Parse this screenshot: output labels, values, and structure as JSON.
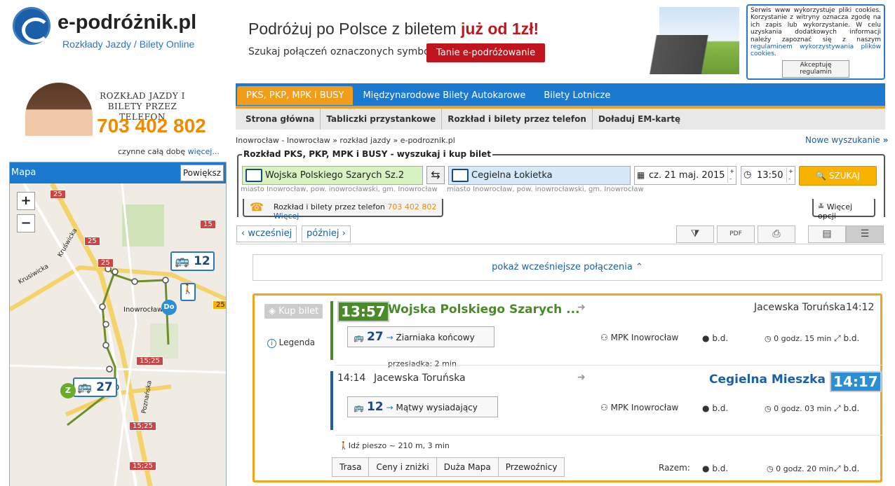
{
  "brand": {
    "name": "e-podróżnik.pl",
    "tagline": "Rozkłady Jazdy / Bilety Online"
  },
  "banner": {
    "line1_a": "Podróżuj po Polsce z biletem ",
    "line1_b": "już od 1zł!",
    "line2": "Szukaj połączeń oznaczonych symbolem",
    "button": "Tanie e-podróżowanie"
  },
  "cookie": {
    "text": "Serwis www wykorzystuje pliki cookies. Korzystanie z witryny oznacza zgodę na ich zapis lub wykorzystanie. W celu uzyskania dodatkowych informacji należy zapoznać się z naszym",
    "link": "regulaminem wykorzystywania plików cookies",
    "dot": ".",
    "accept": "Akceptuję regulamin"
  },
  "phone": {
    "heading": "ROZKŁAD JAZDY I BILETY PRZEZ TELEFON",
    "number": "703 402 802",
    "allday": "czynne całą dobę",
    "more": "więcej..."
  },
  "map": {
    "title": "Mapa",
    "enlarge": "Powiększ",
    "zoom_in": "+",
    "zoom_out": "−",
    "labels": [
      "25",
      "25",
      "25",
      "15",
      "25",
      "15;25",
      "15;25",
      "15;25"
    ],
    "bus1": "12",
    "bus2": "27",
    "dest": "Do",
    "start": "Z",
    "place": "Inowrocław",
    "street": "Poznańska",
    "street2": "Kruświcka",
    "street3": "Krusiwicka"
  },
  "nav": {
    "tabs": [
      "PKS, PKP, MPK i BUSY",
      "Międzynarodowe Bilety Autokarowe",
      "Bilety Lotnicze"
    ],
    "sub": [
      "Strona główna",
      "Tabliczki przystankowe",
      "Rozkład i bilety przez telefon",
      "Doładuj EM-kartę"
    ]
  },
  "breadcrumb": "Inowrocław - Inowrocław » rozkład jazdy » e-podroznik.pl",
  "new_search": "Nowe wyszukanie",
  "search": {
    "title": "Rozkład PKS, PKP, MPK i BUSY - wyszukaj i kup bilet",
    "from": "Wojska Polskiego  Szarych Sz.2",
    "from_sub": "miasto Inowrocław, pow. inowrocławski, gm. Inowrocław",
    "to": "Cegielna Łokietka",
    "to_sub": "miasto Inowrocław, pow. inowrocławski, gm. Inowrocław",
    "date": "cz. 21 maj. 2015",
    "time": "13:50",
    "button": "SZUKAJ",
    "phone_tab": "Rozkład i bilety przez telefon",
    "phone_num": "703 402 802",
    "phone_more": "Więcej",
    "options": "Więcej opcji"
  },
  "pager": {
    "earlier": "wcześniej",
    "later": "później",
    "show_earlier": "pokaż wcześniejsze połączenia"
  },
  "result": {
    "buy": "Kup bilet",
    "legend": "Legenda",
    "leg1": {
      "dep": "13:57",
      "from": "Wojska Polskiego Szarych ...",
      "to": "Jacewska Toruńska",
      "arr": "14:12",
      "line": "27",
      "dir": "Ziarniaka końcowy",
      "operator": "MPK Inowrocław",
      "price": "b.d.",
      "duration": "0 godz. 15 min",
      "dist": "b.d."
    },
    "transfer": "przesiadka: 2 min",
    "leg2": {
      "dep": "14:14",
      "from": "Jacewska Toruńska",
      "to": "Cegielna Mieszka I",
      "arr": "14:17",
      "line": "12",
      "dir": "Mątwy wysiadający",
      "operator": "MPK Inowrocław",
      "price": "b.d.",
      "duration": "0 godz. 03 min",
      "dist": "b.d."
    },
    "walk": "Idź pieszo ~ 210 m, 3 min",
    "tabs": [
      "Trasa",
      "Ceny i zniżki",
      "Duża Mapa",
      "Przewoźnicy"
    ],
    "total_label": "Razem:",
    "total_price": "b.d.",
    "total_duration": "0 godz. 20 min",
    "total_dist": "b.d."
  }
}
